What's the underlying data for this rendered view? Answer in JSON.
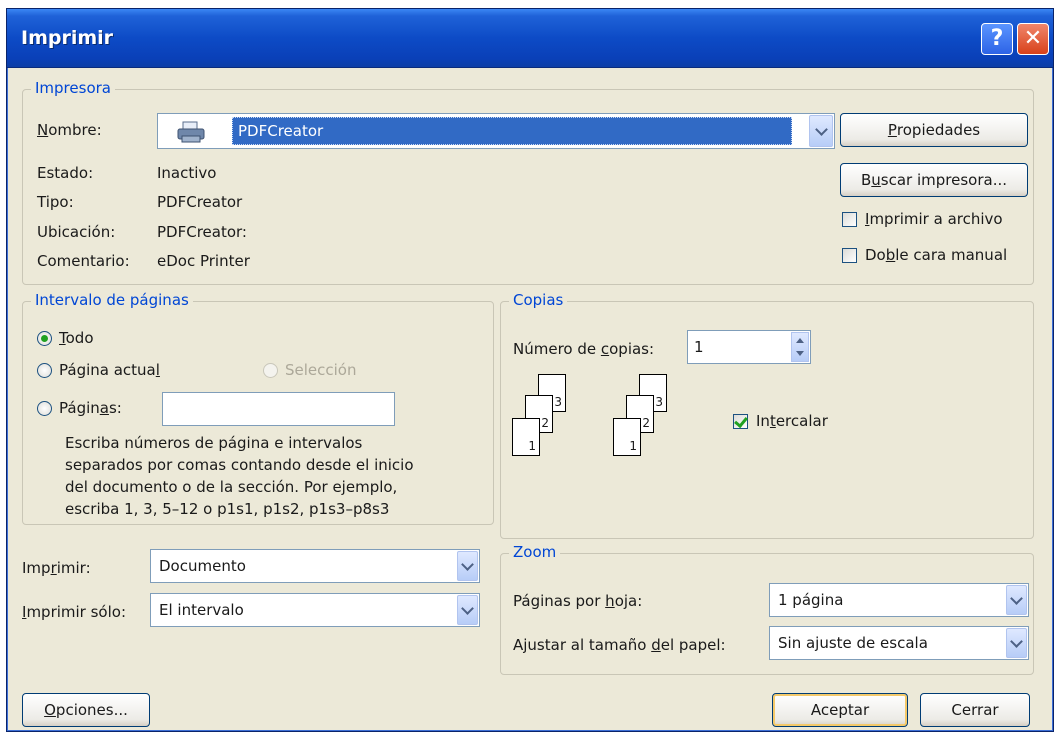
{
  "window": {
    "title": "Imprimir",
    "help_label": "?",
    "close_label": "✕"
  },
  "printer": {
    "group_title": "Impresora",
    "name_label_pre": "",
    "name_label_u": "N",
    "name_label_post": "ombre:",
    "name_value": "PDFCreator",
    "status_label": "Estado:",
    "status_value": "Inactivo",
    "type_label": "Tipo:",
    "type_value": "PDFCreator",
    "location_label": "Ubicación:",
    "location_value": "PDFCreator:",
    "comment_label": "Comentario:",
    "comment_value": "eDoc Printer",
    "properties_pre": "",
    "properties_u": "P",
    "properties_post": "ropiedades",
    "find_pre": "B",
    "find_u": "u",
    "find_post": "scar impresora...",
    "print_to_file_pre": "",
    "print_to_file_u": "I",
    "print_to_file_post": "mprimir a archivo",
    "print_to_file_checked": false,
    "duplex_pre": "Do",
    "duplex_u": "b",
    "duplex_post": "le cara manual",
    "duplex_checked": false
  },
  "page_range": {
    "group_title": "Intervalo de páginas",
    "all_pre": "",
    "all_u": "T",
    "all_post": "odo",
    "current_pre": "Página actua",
    "current_u": "l",
    "current_post": "",
    "selection_label": "Selección",
    "pages_pre": "Págin",
    "pages_u": "a",
    "pages_post": "s:",
    "pages_value": "",
    "selected": "all",
    "help_lines": [
      "Escriba números de página e intervalos",
      "separados por comas contando desde el inicio",
      "del documento o de la sección. Por ejemplo,",
      "escriba 1, 3, 5–12 o p1s1, p1s2, p1s3–p8s3"
    ]
  },
  "copies": {
    "group_title": "Copias",
    "count_pre": "Número de ",
    "count_u": "c",
    "count_post": "opias:",
    "count_value": "1",
    "collate_pre": "In",
    "collate_u": "t",
    "collate_post": "ercalar",
    "collate_checked": true,
    "page_labels": [
      "3",
      "2",
      "1"
    ]
  },
  "print_what": {
    "label_pre": "Imp",
    "label_u": "r",
    "label_post": "imir:",
    "value": "Documento"
  },
  "print_only": {
    "label_pre": "",
    "label_u": "I",
    "label_post": "mprimir sólo:",
    "value": "El intervalo"
  },
  "zoom": {
    "group_title": "Zoom",
    "pages_per_sheet_pre": "Páginas por ",
    "pages_per_sheet_u": "h",
    "pages_per_sheet_post": "oja:",
    "pages_per_sheet_value": "1 página",
    "scale_pre": "Ajustar al tamaño ",
    "scale_u": "d",
    "scale_post": "el papel:",
    "scale_value": "Sin ajuste de escala"
  },
  "footer": {
    "options_pre": "",
    "options_u": "O",
    "options_post": "pciones...",
    "ok_label": "Aceptar",
    "cancel_label": "Cerrar"
  }
}
